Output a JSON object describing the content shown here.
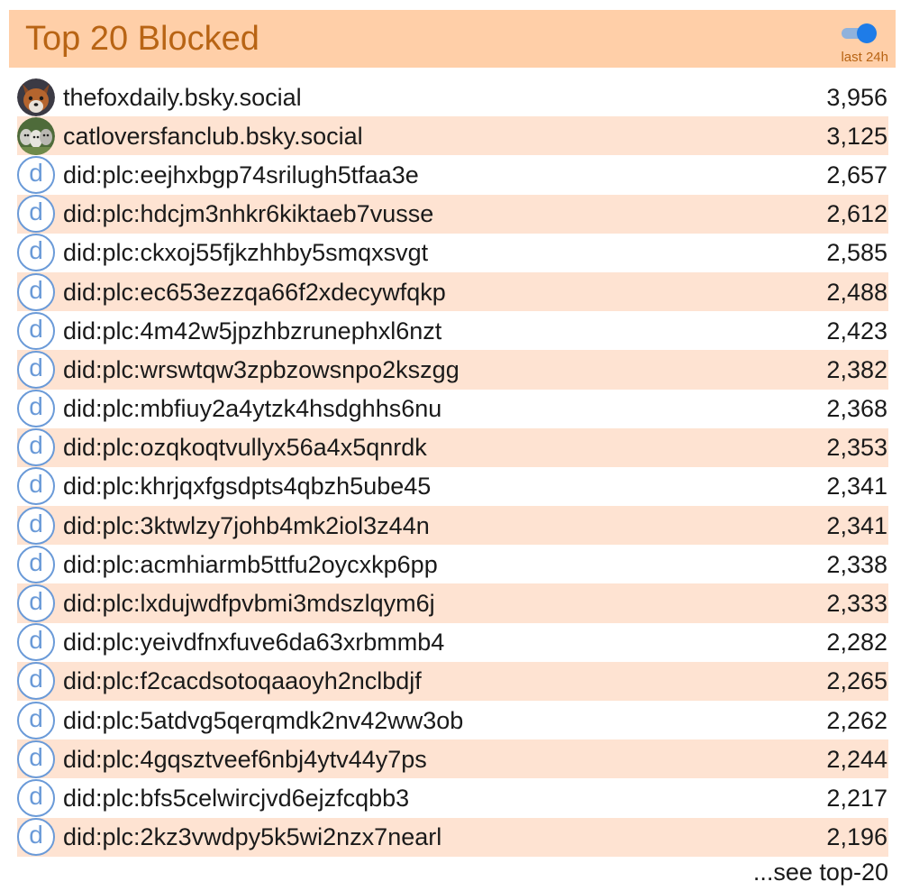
{
  "header": {
    "title": "Top 20 Blocked",
    "toggle_label": "last 24h",
    "toggle_on": true
  },
  "colors": {
    "header_bg": "#ffcfa8",
    "header_text": "#b86414",
    "row_alt_bg": "#fee3d2",
    "did_avatar": "#6a9ad8",
    "toggle_knob": "#1e7ce8",
    "toggle_track": "#8fb2dc"
  },
  "rows": [
    {
      "avatar": "fox-photo",
      "handle": "thefoxdaily.bsky.social",
      "count": "3,956"
    },
    {
      "avatar": "cats-photo",
      "handle": "catloversfanclub.bsky.social",
      "count": "3,125"
    },
    {
      "avatar": "d",
      "handle": "did:plc:eejhxbgp74srilugh5tfaa3e",
      "count": "2,657"
    },
    {
      "avatar": "d",
      "handle": "did:plc:hdcjm3nhkr6kiktaeb7vusse",
      "count": "2,612"
    },
    {
      "avatar": "d",
      "handle": "did:plc:ckxoj55fjkzhhby5smqxsvgt",
      "count": "2,585"
    },
    {
      "avatar": "d",
      "handle": "did:plc:ec653ezzqa66f2xdecywfqkp",
      "count": "2,488"
    },
    {
      "avatar": "d",
      "handle": "did:plc:4m42w5jpzhbzrunephxl6nzt",
      "count": "2,423"
    },
    {
      "avatar": "d",
      "handle": "did:plc:wrswtqw3zpbzowsnpo2kszgg",
      "count": "2,382"
    },
    {
      "avatar": "d",
      "handle": "did:plc:mbfiuy2a4ytzk4hsdghhs6nu",
      "count": "2,368"
    },
    {
      "avatar": "d",
      "handle": "did:plc:ozqkoqtvullyx56a4x5qnrdk",
      "count": "2,353"
    },
    {
      "avatar": "d",
      "handle": "did:plc:khrjqxfgsdpts4qbzh5ube45",
      "count": "2,341"
    },
    {
      "avatar": "d",
      "handle": "did:plc:3ktwlzy7johb4mk2iol3z44n",
      "count": "2,341"
    },
    {
      "avatar": "d",
      "handle": "did:plc:acmhiarmb5ttfu2oycxkp6pp",
      "count": "2,338"
    },
    {
      "avatar": "d",
      "handle": "did:plc:lxdujwdfpvbmi3mdszlqym6j",
      "count": "2,333"
    },
    {
      "avatar": "d",
      "handle": "did:plc:yeivdfnxfuve6da63xrbmmb4",
      "count": "2,282"
    },
    {
      "avatar": "d",
      "handle": "did:plc:f2cacdsotoqaaoyh2nclbdjf",
      "count": "2,265"
    },
    {
      "avatar": "d",
      "handle": "did:plc:5atdvg5qerqmdk2nv42ww3ob",
      "count": "2,262"
    },
    {
      "avatar": "d",
      "handle": "did:plc:4gqsztveef6nbj4ytv44y7ps",
      "count": "2,244"
    },
    {
      "avatar": "d",
      "handle": "did:plc:bfs5celwircjvd6ejzfcqbb3",
      "count": "2,217"
    },
    {
      "avatar": "d",
      "handle": "did:plc:2kz3vwdpy5k5wi2nzx7nearl",
      "count": "2,196"
    }
  ],
  "footer": {
    "see_more": "...see top-20"
  }
}
